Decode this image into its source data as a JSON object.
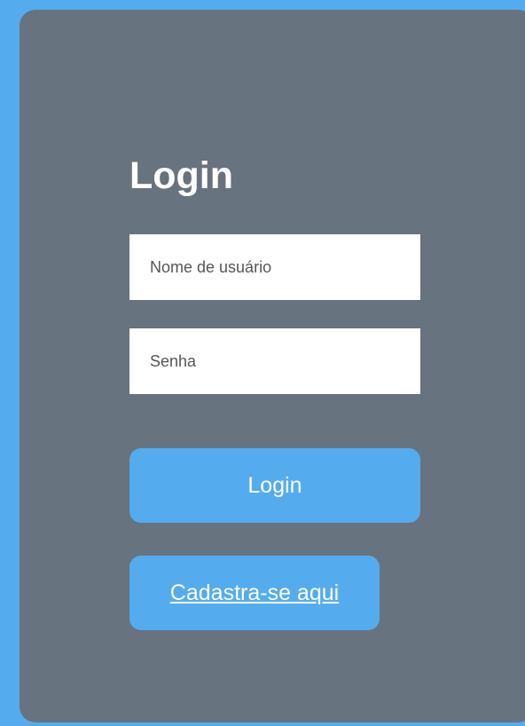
{
  "login_form": {
    "title": "Login",
    "username_placeholder": "Nome de usuário",
    "username_value": "",
    "password_placeholder": "Senha",
    "password_value": "",
    "login_button_label": "Login",
    "register_link_label": "Cadastra-se aqui"
  },
  "colors": {
    "page_background": "#54acee",
    "card_background": "#67737e",
    "accent": "#54acee",
    "text_on_dark": "#ffffff",
    "field_background": "#ffffff"
  }
}
